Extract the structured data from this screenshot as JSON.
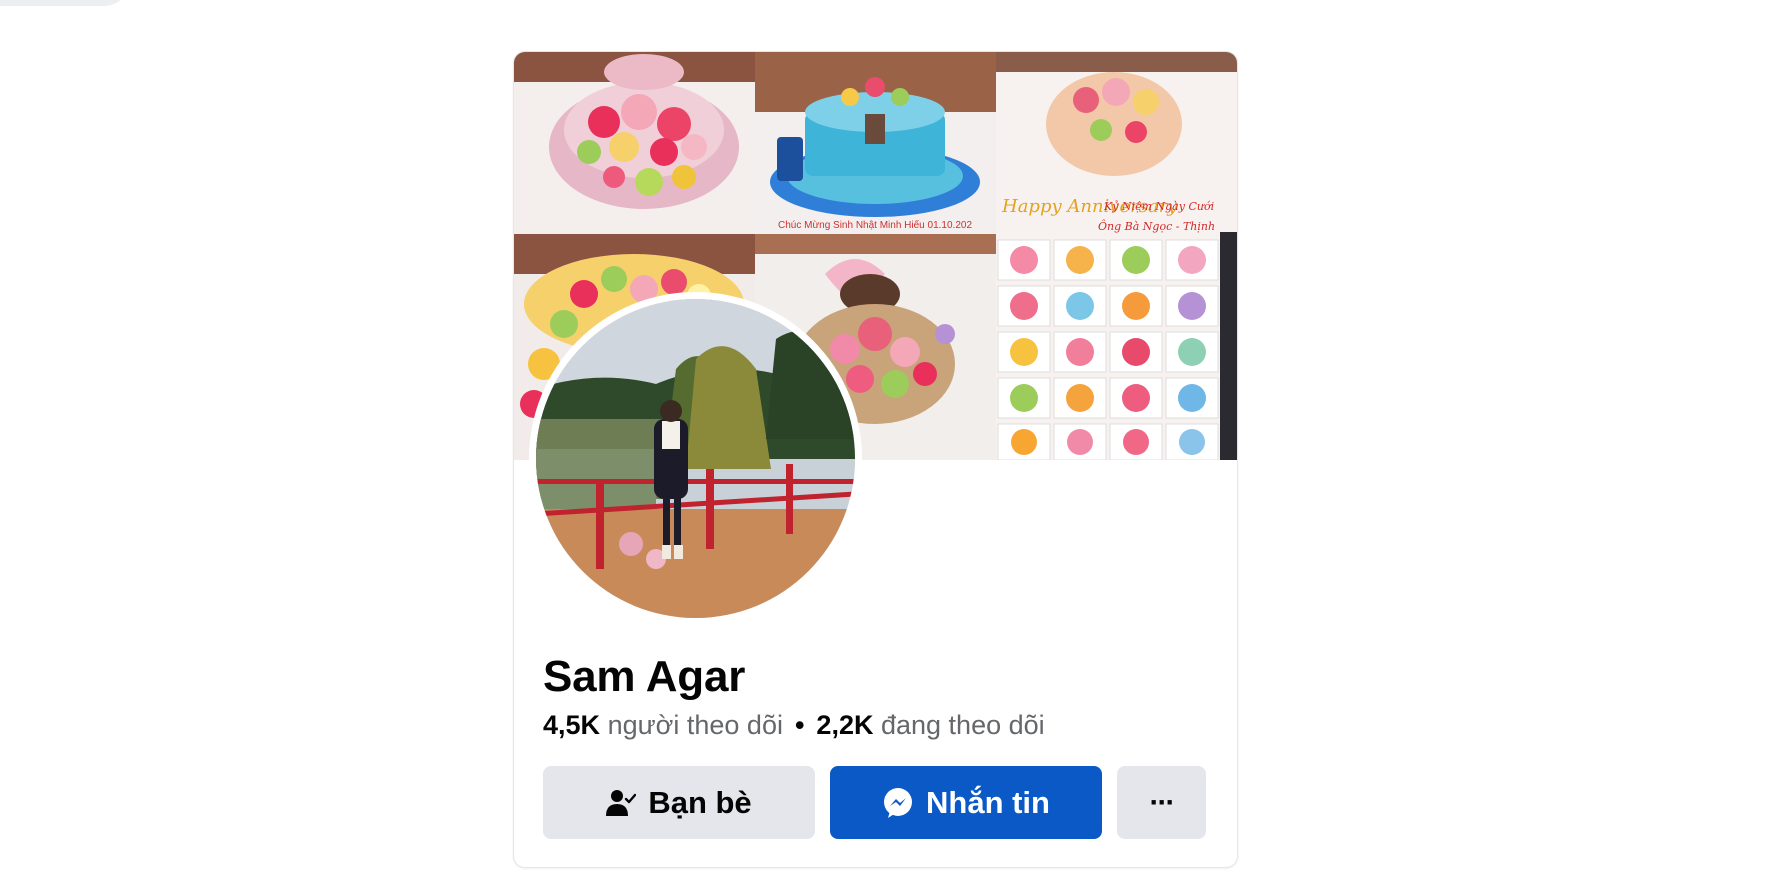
{
  "profile": {
    "name": "Sam Agar",
    "followers_count": "4,5K",
    "followers_label": "người theo dõi",
    "separator": "•",
    "following_count": "2,2K",
    "following_label": "đang theo dõi"
  },
  "cover_text": {
    "banner_line1": "Kỷ Niệm Ngày Cưới",
    "banner_line2": "Ông Bà Ngọc - Thịnh",
    "script_text": "Happy Anniversary"
  },
  "actions": {
    "friends_label": "Bạn bè",
    "friends_icon": "friend-check-icon",
    "message_label": "Nhắn tin",
    "message_icon": "messenger-icon",
    "more_label": "···",
    "more_icon": "more-dots-icon"
  },
  "colors": {
    "primary_button": "#0a59c7",
    "secondary_button": "#e4e6eb",
    "text_primary": "#050505",
    "text_secondary": "#65676b"
  }
}
